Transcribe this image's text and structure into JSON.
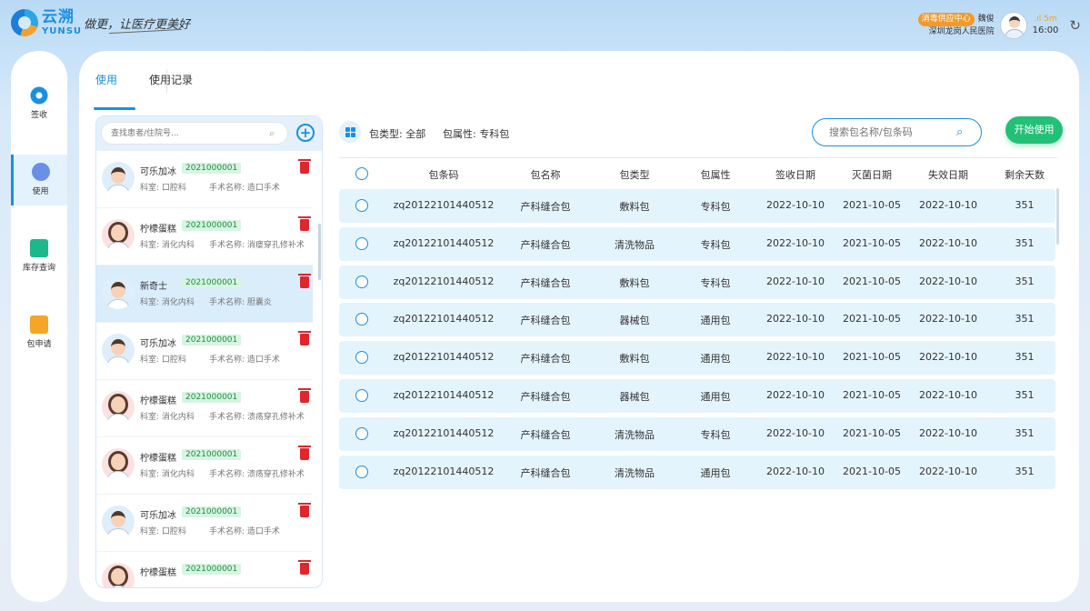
{
  "header": {
    "logo_cn": "云溯",
    "logo_en": "YUNSU",
    "slogan": "做更，让医疗更美好",
    "dept_badge": "消毒供应中心",
    "user_name": "魏俊",
    "hospital": "深圳龙岗人民医院",
    "signal": ".ıl 5m",
    "time": "16:00",
    "refresh_icon": "refresh-icon"
  },
  "nav": {
    "items": [
      {
        "label": "签收",
        "icon": "sign-icon",
        "color": "#1a8fe3"
      },
      {
        "label": "使用",
        "icon": "use-icon",
        "color": "#6b8fe6"
      },
      {
        "label": "库存查询",
        "icon": "stock-icon",
        "color": "#1cb88a"
      },
      {
        "label": "包申请",
        "icon": "box-icon",
        "color": "#f5a623"
      }
    ]
  },
  "tabs": [
    {
      "label": "使用",
      "active": true
    },
    {
      "label": "使用记录",
      "active": false
    }
  ],
  "patient_panel": {
    "search_placeholder": "查找患者/住院号...",
    "dept_prefix": "科室:",
    "surgery_prefix": "手术名称:",
    "patients": [
      {
        "name": "可乐加冰",
        "id": "2021000001",
        "dept": "口腔科",
        "surgery": "造口手术",
        "gender": "m"
      },
      {
        "name": "柠檬蛋糕",
        "id": "2021000001",
        "dept": "消化内科",
        "surgery": "消瘘穿孔修补术",
        "gender": "f"
      },
      {
        "name": "新奇士",
        "id": "2021000001",
        "dept": "消化内科",
        "surgery": "胆囊炎",
        "gender": "m"
      },
      {
        "name": "可乐加冰",
        "id": "2021000001",
        "dept": "口腔科",
        "surgery": "造口手术",
        "gender": "m"
      },
      {
        "name": "柠檬蛋糕",
        "id": "2021000001",
        "dept": "消化内科",
        "surgery": "溃疡穿孔修补术",
        "gender": "f"
      },
      {
        "name": "柠檬蛋糕",
        "id": "2021000001",
        "dept": "消化内科",
        "surgery": "溃疡穿孔修补术",
        "gender": "f"
      },
      {
        "name": "可乐加冰",
        "id": "2021000001",
        "dept": "口腔科",
        "surgery": "造口手术",
        "gender": "m"
      },
      {
        "name": "柠檬蛋糕",
        "id": "2021000001",
        "dept": "",
        "surgery": "",
        "gender": "f"
      }
    ]
  },
  "filters": {
    "type": "包类型: 全部",
    "attr": "包属性: 专科包"
  },
  "search": {
    "placeholder": "搜索包名称/包条码"
  },
  "start_button": "开始使用",
  "table": {
    "headers": [
      "包条码",
      "包名称",
      "包类型",
      "包属性",
      "签收日期",
      "灭菌日期",
      "失效日期",
      "剩余天数"
    ],
    "rows": [
      [
        "zq20122101440512",
        "产科缝合包",
        "敷料包",
        "专科包",
        "2022-10-10",
        "2021-10-05",
        "2022-10-10",
        "351"
      ],
      [
        "zq20122101440512",
        "产科缝合包",
        "清洗物品",
        "专科包",
        "2022-10-10",
        "2021-10-05",
        "2022-10-10",
        "351"
      ],
      [
        "zq20122101440512",
        "产科缝合包",
        "敷料包",
        "专科包",
        "2022-10-10",
        "2021-10-05",
        "2022-10-10",
        "351"
      ],
      [
        "zq20122101440512",
        "产科缝合包",
        "器械包",
        "通用包",
        "2022-10-10",
        "2021-10-05",
        "2022-10-10",
        "351"
      ],
      [
        "zq20122101440512",
        "产科缝合包",
        "敷料包",
        "通用包",
        "2022-10-10",
        "2021-10-05",
        "2022-10-10",
        "351"
      ],
      [
        "zq20122101440512",
        "产科缝合包",
        "器械包",
        "通用包",
        "2022-10-10",
        "2021-10-05",
        "2022-10-10",
        "351"
      ],
      [
        "zq20122101440512",
        "产科缝合包",
        "清洗物品",
        "专科包",
        "2022-10-10",
        "2021-10-05",
        "2022-10-10",
        "351"
      ],
      [
        "zq20122101440512",
        "产科缝合包",
        "清洗物品",
        "通用包",
        "2022-10-10",
        "2021-10-05",
        "2022-10-10",
        "351"
      ]
    ]
  }
}
